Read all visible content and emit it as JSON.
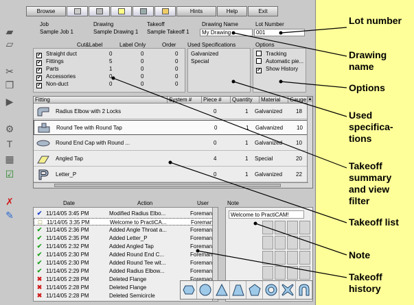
{
  "toolbar": {
    "browse": "Browse",
    "hints": "Hints",
    "help": "Help",
    "exit": "Exit"
  },
  "job": {
    "job_label": "Job",
    "job_value": "Sample Job 1",
    "drawing_label": "Drawing",
    "drawing_value": "Sample Drawing 1",
    "takeoff_label": "Takeoff",
    "takeoff_value": "Sample Takeoff 1",
    "drawing_name_label": "Drawing Name",
    "drawing_name_value": "My Drawing",
    "lot_number_label": "Lot Number",
    "lot_number_value": "001"
  },
  "summary": {
    "col_cutlabel": "Cut&Label",
    "col_labelonly": "Label Only",
    "col_order": "Order",
    "rows": [
      {
        "name": "Straight duct",
        "checked": true,
        "cut": "0",
        "label": "0",
        "order": "0"
      },
      {
        "name": "Fittings",
        "checked": true,
        "cut": "5",
        "label": "0",
        "order": "0"
      },
      {
        "name": "Parts",
        "checked": true,
        "cut": "1",
        "label": "0",
        "order": "0"
      },
      {
        "name": "Accessories",
        "checked": true,
        "cut": "0",
        "label": "0",
        "order": "0"
      },
      {
        "name": "Non-duct",
        "checked": true,
        "cut": "0",
        "label": "0",
        "order": "0"
      }
    ]
  },
  "specs": {
    "header": "Used Specifications",
    "items": [
      "Galvanized",
      "Special"
    ]
  },
  "options": {
    "header": "Options",
    "items": [
      {
        "label": "Tracking",
        "checked": false
      },
      {
        "label": "Automatic pie...",
        "checked": false
      },
      {
        "label": "Show History",
        "checked": true
      }
    ]
  },
  "takeoff": {
    "columns": [
      "Fitting",
      "System #",
      "Piece #",
      "Quantity",
      "Material",
      "Gauge"
    ],
    "rows": [
      {
        "fitting": "Radius Elbow with 2 Locks",
        "system": "",
        "piece": "0",
        "qty": "1",
        "material": "Galvanized",
        "gauge": "18",
        "selected": false
      },
      {
        "fitting": "Round Tee with Round Tap",
        "system": "",
        "piece": "0",
        "qty": "1",
        "material": "Galvanized",
        "gauge": "10",
        "selected": true
      },
      {
        "fitting": "Round End Cap with Round ...",
        "system": "",
        "piece": "0",
        "qty": "1",
        "material": "Galvanized",
        "gauge": "10",
        "selected": false
      },
      {
        "fitting": "Angled Tap",
        "system": "",
        "piece": "4",
        "qty": "1",
        "material": "Special",
        "gauge": "20",
        "selected": false
      },
      {
        "fitting": "Letter_P",
        "system": "",
        "piece": "0",
        "qty": "1",
        "material": "Galvanized",
        "gauge": "22",
        "selected": false
      }
    ]
  },
  "history": {
    "col_date": "Date",
    "col_action": "Action",
    "col_user": "User",
    "rows": [
      {
        "mark": "✔",
        "color": "#1a3cc8",
        "date": "11/14/05 3:45 PM",
        "action": "Modified Radius Elbo...",
        "user": "Foreman",
        "selected": false
      },
      {
        "mark": "□",
        "color": "#777700",
        "date": "11/14/05 3:35 PM",
        "action": "Welcome to PractiCA...",
        "user": "Foreman",
        "selected": true
      },
      {
        "mark": "✔",
        "color": "#1aa01a",
        "date": "11/14/05 2:36 PM",
        "action": "Added Angle Throat a...",
        "user": "Foreman",
        "selected": false
      },
      {
        "mark": "✔",
        "color": "#1aa01a",
        "date": "11/14/05 2:35 PM",
        "action": "Added Letter_P",
        "user": "Foreman",
        "selected": false
      },
      {
        "mark": "✔",
        "color": "#1aa01a",
        "date": "11/14/05 2:32 PM",
        "action": "Added Angled Tap",
        "user": "Foreman",
        "selected": false
      },
      {
        "mark": "✔",
        "color": "#1aa01a",
        "date": "11/14/05 2:30 PM",
        "action": "Added Round End C...",
        "user": "Foreman",
        "selected": false
      },
      {
        "mark": "✔",
        "color": "#1aa01a",
        "date": "11/14/05 2:30 PM",
        "action": "Added Round Tee wit...",
        "user": "Foreman",
        "selected": false
      },
      {
        "mark": "✔",
        "color": "#1aa01a",
        "date": "11/14/05 2:29 PM",
        "action": "Added Radius Elbow...",
        "user": "Foreman",
        "selected": false
      },
      {
        "mark": "✖",
        "color": "#d01a1a",
        "date": "11/14/05 2:28 PM",
        "action": "Deleted Flange",
        "user": "Foreman",
        "selected": false
      },
      {
        "mark": "✖",
        "color": "#d01a1a",
        "date": "11/14/05 2:28 PM",
        "action": "Deleted Flange",
        "user": "Foreman",
        "selected": false
      },
      {
        "mark": "✖",
        "color": "#d01a1a",
        "date": "11/14/05 2:28 PM",
        "action": "Deleted Semicircle",
        "user": "Foreman",
        "selected": false
      }
    ]
  },
  "note": {
    "header": "Note",
    "text": "Welcome to PractiCAM!"
  },
  "callouts": {
    "lot_number": "Lot number",
    "drawing_name": "Drawing name",
    "options": "Options",
    "used_specs": "Used specifica-tions",
    "takeoff_summary": "Takeoff summary and view filter",
    "takeoff_list": "Takeoff list",
    "note": "Note",
    "takeoff_history": "Takeoff history"
  }
}
